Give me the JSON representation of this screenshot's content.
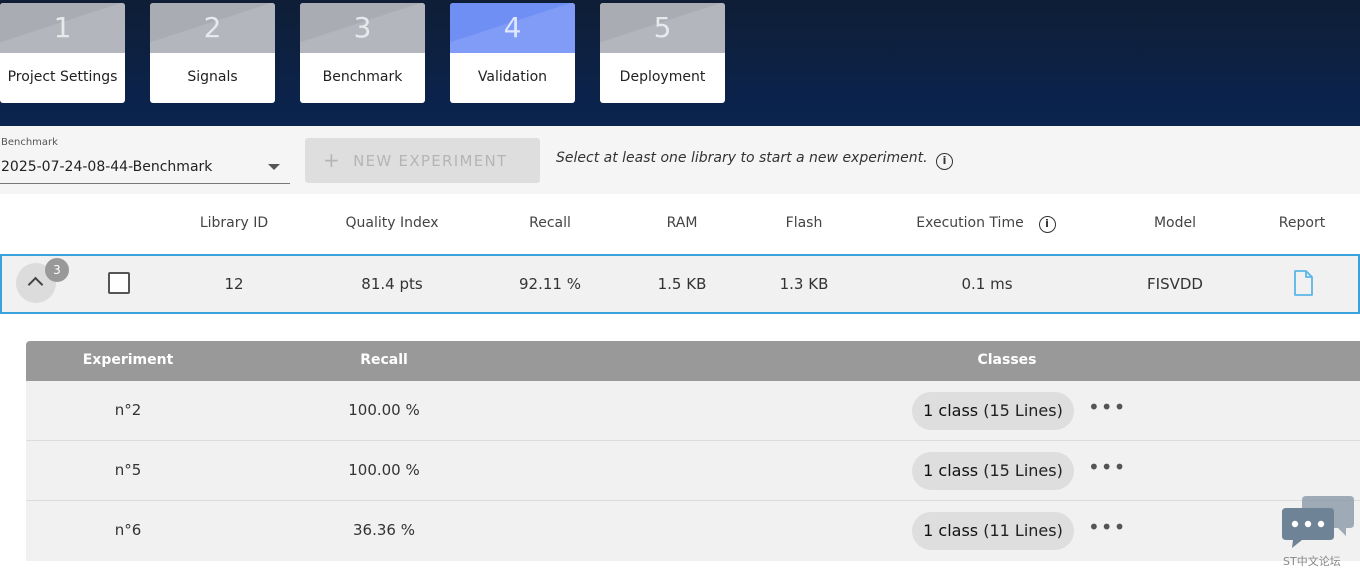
{
  "steps": [
    {
      "num": "1",
      "label": "Project Settings"
    },
    {
      "num": "2",
      "label": "Signals"
    },
    {
      "num": "3",
      "label": "Benchmark"
    },
    {
      "num": "4",
      "label": "Validation"
    },
    {
      "num": "5",
      "label": "Deployment"
    }
  ],
  "active_step": 4,
  "toolbar": {
    "benchmark_label": "Benchmark",
    "benchmark_value": "2025-07-24-08-44-Benchmark",
    "new_experiment_label": "NEW EXPERIMENT",
    "hint": "Select at least one library to start a new experiment."
  },
  "table": {
    "headers": {
      "library_id": "Library ID",
      "quality_index": "Quality Index",
      "recall": "Recall",
      "ram": "RAM",
      "flash": "Flash",
      "execution_time": "Execution Time",
      "model": "Model",
      "report": "Report"
    },
    "row": {
      "badge": "3",
      "library_id": "12",
      "quality_index": "81.4 pts",
      "recall": "92.11 %",
      "ram": "1.5 KB",
      "flash": "1.3 KB",
      "execution_time": "0.1 ms",
      "model": "FISVDD"
    }
  },
  "experiments": {
    "headers": {
      "experiment": "Experiment",
      "recall": "Recall",
      "classes": "Classes"
    },
    "rows": [
      {
        "experiment": "n°2",
        "recall": "100.00 %",
        "classes_count": "1 class",
        "classes_lines": "(15 Lines)"
      },
      {
        "experiment": "n°5",
        "recall": "100.00 %",
        "classes_count": "1 class",
        "classes_lines": "(15 Lines)"
      },
      {
        "experiment": "n°6",
        "recall": "36.36 %",
        "classes_count": "1 class",
        "classes_lines": "(11 Lines)"
      }
    ]
  },
  "chat": {
    "caption": "ST中文论坛"
  },
  "colors": {
    "header_bg": "#0a2450",
    "active_step": "#6f8ff5",
    "row_border": "#3aa3dc"
  }
}
